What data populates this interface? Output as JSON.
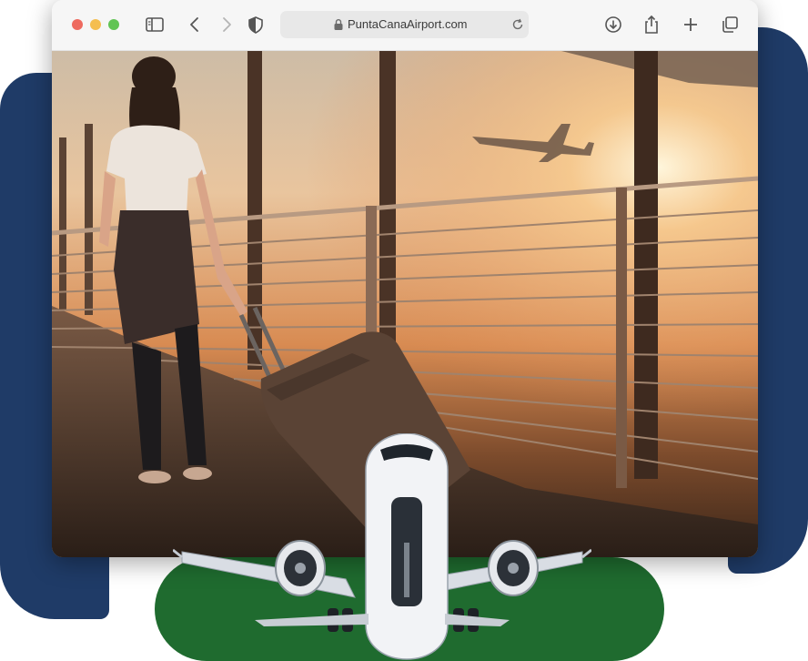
{
  "browser": {
    "url": "PuntaCanaAirport.com",
    "icons": [
      "sidebar-icon",
      "back-icon",
      "forward-icon",
      "shield-icon",
      "lock-icon",
      "reload-icon",
      "download-icon",
      "share-icon",
      "new-tab-icon",
      "tabs-icon"
    ]
  },
  "colors": {
    "blob_blue": "#1f3b67",
    "blob_green": "#1f6b2f",
    "sunset_orange": "#e08a4a",
    "traffic_red": "#ee6a5f",
    "traffic_yellow": "#f5be4f",
    "traffic_green": "#61c454"
  }
}
